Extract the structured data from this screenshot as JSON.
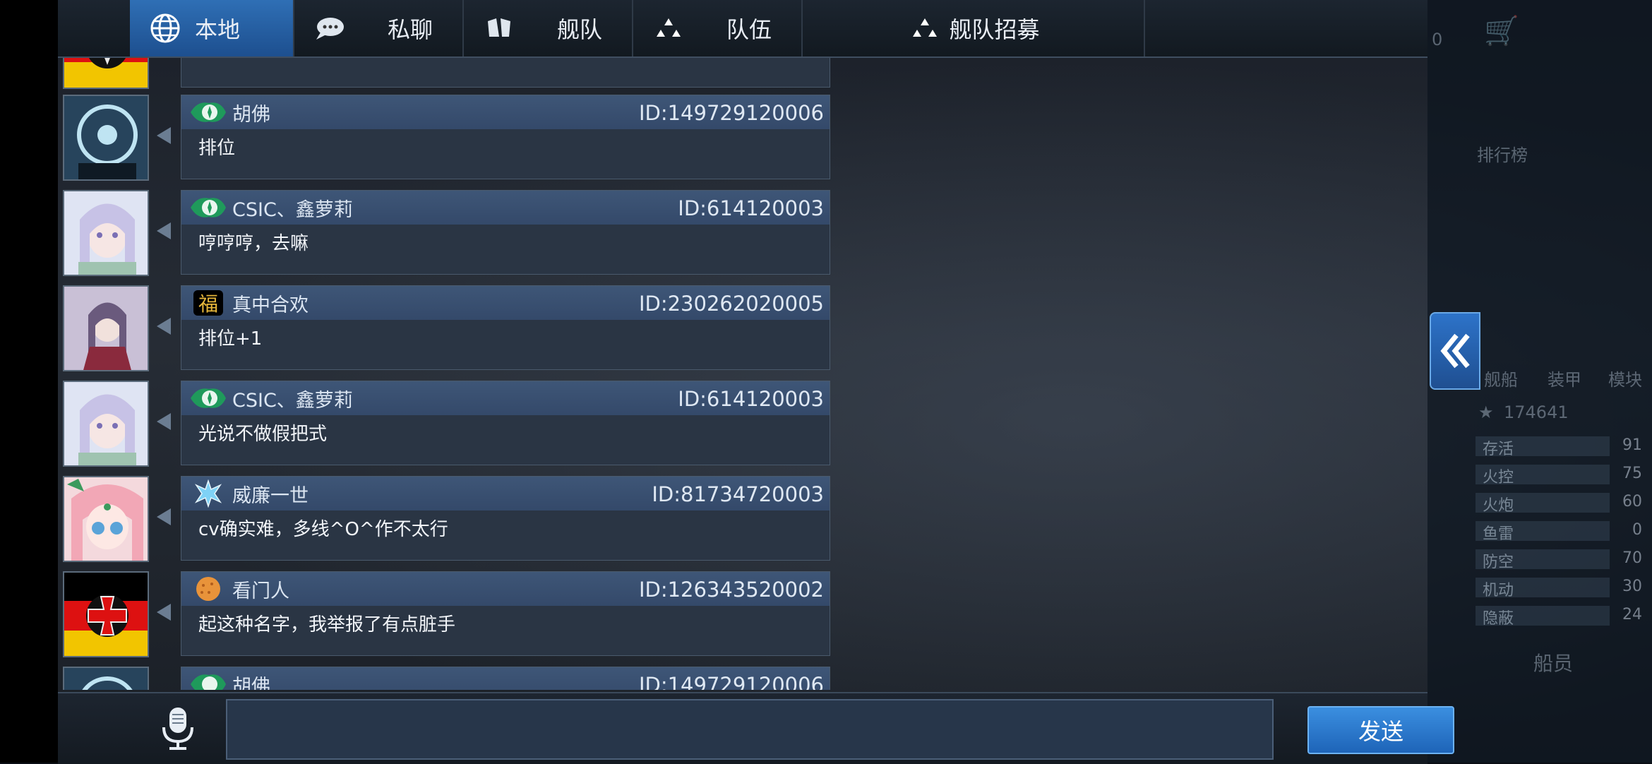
{
  "tabs": [
    {
      "label": "本地",
      "icon": "globe-icon",
      "active": true
    },
    {
      "label": "私聊",
      "icon": "speech-bubble-icon",
      "active": false
    },
    {
      "label": "舰队",
      "icon": "fleet-icon",
      "active": false
    },
    {
      "label": "队伍",
      "icon": "team-icon",
      "active": false
    },
    {
      "label": "舰队招募",
      "icon": "recruit-icon",
      "active": false
    }
  ],
  "messages": [
    {
      "name": "胡佛",
      "id": "ID:149729120006",
      "text": "排位",
      "badge": "compass-badge"
    },
    {
      "name": "CSIC、鑫萝莉",
      "id": "ID:614120003",
      "text": "哼哼哼，去嘛",
      "badge": "compass-badge"
    },
    {
      "name": "真中合欢",
      "id": "ID:230262020005",
      "text": "排位+1",
      "badge": "fu-badge"
    },
    {
      "name": "CSIC、鑫萝莉",
      "id": "ID:614120003",
      "text": "光说不做假把式",
      "badge": "compass-badge"
    },
    {
      "name": "威廉一世",
      "id": "ID:81734720003",
      "text": "cv确实难，多线^O^作不太行",
      "badge": "snowflake-badge"
    },
    {
      "name": "看门人",
      "id": "ID:126343520002",
      "text": "起这种名字，我举报了有点脏手",
      "badge": "cookie-badge"
    },
    {
      "name": "胡佛",
      "id": "ID:149729120006",
      "text": "",
      "badge": "compass-badge"
    }
  ],
  "input": {
    "placeholder": "",
    "send_label": "发送"
  },
  "right_panel": {
    "rank_label": "排行榜",
    "tabs": [
      "舰船",
      "装甲",
      "模块"
    ],
    "score": "174641",
    "stats": [
      {
        "label": "存活",
        "value": "91"
      },
      {
        "label": "火控",
        "value": "75"
      },
      {
        "label": "火炮",
        "value": "60"
      },
      {
        "label": "鱼雷",
        "value": "0"
      },
      {
        "label": "防空",
        "value": "70"
      },
      {
        "label": "机动",
        "value": "30"
      },
      {
        "label": "隐蔽",
        "value": "24"
      }
    ],
    "crew_label": "船员",
    "top_value": "0"
  },
  "colors": {
    "accent": "#2f6fb5",
    "bubble_head": "#3e5677",
    "bubble_body": "#2a3544"
  }
}
